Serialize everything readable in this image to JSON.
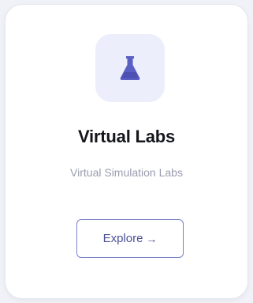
{
  "card": {
    "title": "Virtual Labs",
    "subtitle": "Virtual Simulation Labs",
    "icon": "flask-icon",
    "button": {
      "label": "Explore",
      "arrow": "→"
    }
  },
  "colors": {
    "accent": "#5a5fc4",
    "icon_tile_bg": "#eceefb",
    "button_border": "#7b81c9"
  }
}
